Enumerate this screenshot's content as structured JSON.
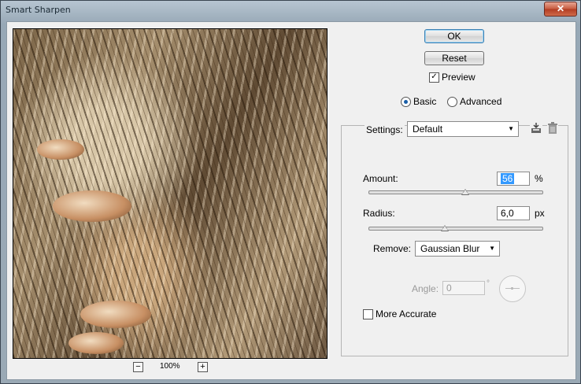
{
  "window": {
    "title": "Smart Sharpen",
    "close_glyph": "✕"
  },
  "preview": {
    "zoom_out_glyph": "−",
    "zoom_in_glyph": "+",
    "zoom_label": "100%"
  },
  "buttons": {
    "ok": "OK",
    "reset": "Reset"
  },
  "preview_toggle": {
    "label": "Preview",
    "checked": true,
    "check_glyph": "✓"
  },
  "mode": {
    "basic_label": "Basic",
    "advanced_label": "Advanced",
    "selected": "Basic"
  },
  "settings": {
    "label": "Settings:",
    "value": "Default",
    "arrow_glyph": "▼",
    "save_icon": "save-settings-icon",
    "delete_icon": "trash-icon"
  },
  "amount": {
    "label": "Amount:",
    "value": "56",
    "unit": "%",
    "slider_fraction": 0.56
  },
  "radius": {
    "label": "Radius:",
    "value": "6,0",
    "unit": "px",
    "slider_fraction": 0.44
  },
  "remove": {
    "label": "Remove:",
    "value": "Gaussian Blur",
    "arrow_glyph": "▼"
  },
  "angle": {
    "label": "Angle:",
    "value": "0",
    "unit": "°"
  },
  "more_accurate": {
    "label": "More Accurate",
    "checked": false
  },
  "colors": {
    "accent": "#3399ff",
    "dialog_bg": "#f0f0f0",
    "close_red": "#c75a3e"
  }
}
